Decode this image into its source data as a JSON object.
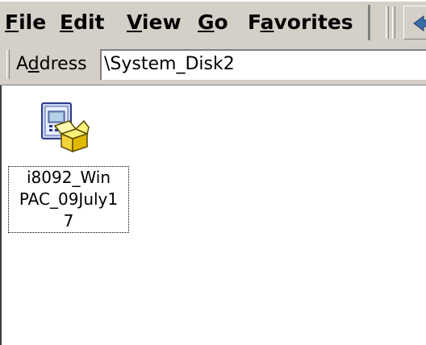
{
  "menubar": {
    "items": [
      {
        "accel": "F",
        "rest": "ile"
      },
      {
        "accel": "E",
        "rest": "dit"
      },
      {
        "accel": "V",
        "rest": "iew"
      },
      {
        "accel": "G",
        "rest": "o"
      },
      {
        "pre": "F",
        "accel": "a",
        "rest": "vorites"
      }
    ],
    "back_icon": "back-arrow-icon",
    "colors": {
      "bar": "#d4d0c8",
      "arrow": "#3a6ea5"
    }
  },
  "address": {
    "label_pre": "A",
    "label_accel": "d",
    "label_rest": "dress",
    "value": "\\System_Disk2"
  },
  "files": [
    {
      "icon": "installer-package-icon",
      "label_lines": [
        "i8092_Win",
        "PAC_09July1",
        "7"
      ]
    }
  ]
}
